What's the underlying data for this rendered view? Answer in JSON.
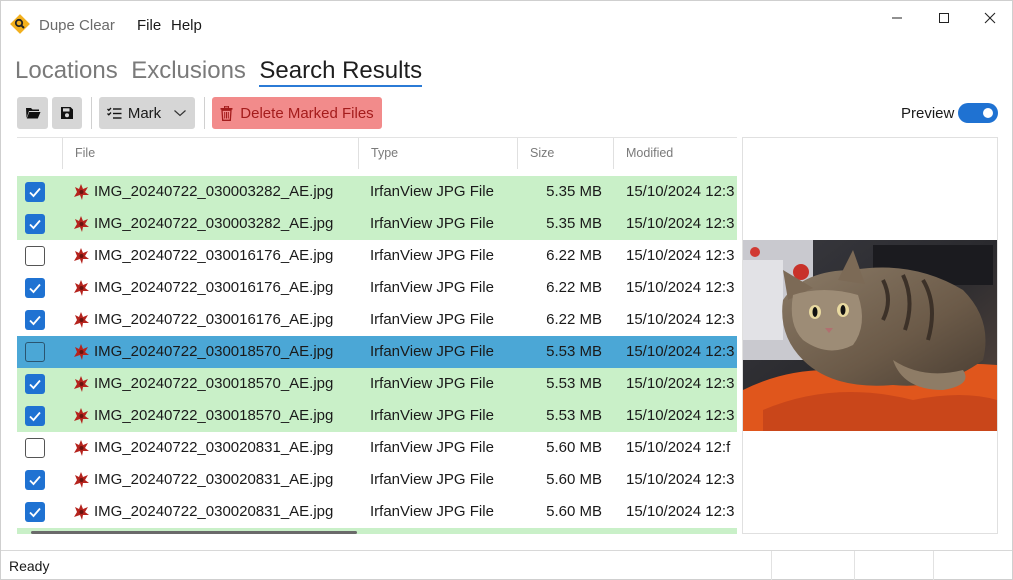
{
  "app": {
    "title": "Dupe Clear",
    "menu": [
      "File",
      "Help"
    ]
  },
  "tabs": [
    "Locations",
    "Exclusions",
    "Search Results"
  ],
  "active_tab": 2,
  "toolbar": {
    "open_icon": "folder-open-icon",
    "save_icon": "save-icon",
    "mark_label": "Mark",
    "delete_label": "Delete Marked Files",
    "preview_label": "Preview",
    "preview_enabled": true
  },
  "table": {
    "columns": [
      "File",
      "Type",
      "Size",
      "Modified"
    ],
    "rows": [
      {
        "checked": true,
        "state": "green",
        "file": "IMG_20240722_030003282_AE.jpg",
        "type": "IrfanView JPG File",
        "size": "5.35 MB",
        "modified": "15/10/2024 12:3"
      },
      {
        "checked": true,
        "state": "green",
        "file": "IMG_20240722_030003282_AE.jpg",
        "type": "IrfanView JPG File",
        "size": "5.35 MB",
        "modified": "15/10/2024 12:3"
      },
      {
        "checked": false,
        "state": "white",
        "file": "IMG_20240722_030016176_AE.jpg",
        "type": "IrfanView JPG File",
        "size": "6.22 MB",
        "modified": "15/10/2024 12:3"
      },
      {
        "checked": true,
        "state": "white",
        "file": "IMG_20240722_030016176_AE.jpg",
        "type": "IrfanView JPG File",
        "size": "6.22 MB",
        "modified": "15/10/2024 12:3"
      },
      {
        "checked": true,
        "state": "white",
        "file": "IMG_20240722_030016176_AE.jpg",
        "type": "IrfanView JPG File",
        "size": "6.22 MB",
        "modified": "15/10/2024 12:3"
      },
      {
        "checked": false,
        "state": "selected",
        "file": "IMG_20240722_030018570_AE.jpg",
        "type": "IrfanView JPG File",
        "size": "5.53 MB",
        "modified": "15/10/2024 12:3"
      },
      {
        "checked": true,
        "state": "green",
        "file": "IMG_20240722_030018570_AE.jpg",
        "type": "IrfanView JPG File",
        "size": "5.53 MB",
        "modified": "15/10/2024 12:3"
      },
      {
        "checked": true,
        "state": "green",
        "file": "IMG_20240722_030018570_AE.jpg",
        "type": "IrfanView JPG File",
        "size": "5.53 MB",
        "modified": "15/10/2024 12:3"
      },
      {
        "checked": false,
        "state": "white",
        "file": "IMG_20240722_030020831_AE.jpg",
        "type": "IrfanView JPG File",
        "size": "5.60 MB",
        "modified": "15/10/2024 12:f"
      },
      {
        "checked": true,
        "state": "white",
        "file": "IMG_20240722_030020831_AE.jpg",
        "type": "IrfanView JPG File",
        "size": "5.60 MB",
        "modified": "15/10/2024 12:3"
      },
      {
        "checked": true,
        "state": "white",
        "file": "IMG_20240722_030020831_AE.jpg",
        "type": "IrfanView JPG File",
        "size": "5.60 MB",
        "modified": "15/10/2024 12:3"
      }
    ]
  },
  "preview": {
    "image_subject": "cat-photo"
  },
  "status": {
    "text": "Ready"
  },
  "colors": {
    "accent": "#1f72d2",
    "row_green": "#c9f0c8",
    "row_selected": "#4ba7d6",
    "delete_bg": "#f28b8b",
    "delete_text": "#a41c1c",
    "file_icon": "#b5231d"
  }
}
